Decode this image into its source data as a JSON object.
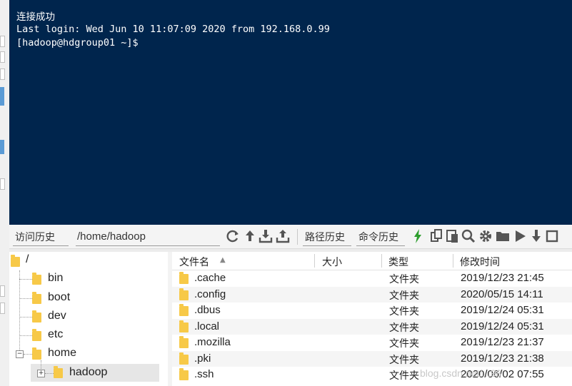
{
  "terminal": {
    "line1": "连接成功",
    "line2": "Last login: Wed Jun 10 11:07:09 2020 from 192.168.0.99",
    "line3": "[hadoop@hdgroup01 ~]$"
  },
  "toolbar": {
    "history_label": "访问历史",
    "path_value": "/home/hadoop",
    "path_history_label": "路径历史",
    "command_history_label": "命令历史"
  },
  "tree": {
    "root": "/",
    "items": [
      "bin",
      "boot",
      "dev",
      "etc",
      "home"
    ],
    "selected": "hadoop"
  },
  "filelist": {
    "columns": [
      "文件名",
      "大小",
      "类型",
      "修改时间"
    ],
    "rows": [
      {
        "name": ".cache",
        "size": "",
        "type": "文件夹",
        "modified": "2019/12/23 21:45"
      },
      {
        "name": ".config",
        "size": "",
        "type": "文件夹",
        "modified": "2020/05/15 14:11"
      },
      {
        "name": ".dbus",
        "size": "",
        "type": "文件夹",
        "modified": "2019/12/24 05:31"
      },
      {
        "name": ".local",
        "size": "",
        "type": "文件夹",
        "modified": "2019/12/24 05:31"
      },
      {
        "name": ".mozilla",
        "size": "",
        "type": "文件夹",
        "modified": "2019/12/23 21:37"
      },
      {
        "name": ".pki",
        "size": "",
        "type": "文件夹",
        "modified": "2019/12/23 21:38"
      },
      {
        "name": ".ssh",
        "size": "",
        "type": "文件夹",
        "modified": "2020/06/02 07:55"
      }
    ]
  },
  "watermark": "blog.csdn.net/...98",
  "colors": {
    "terminal_bg": "#00254d",
    "folder": "#f7c948",
    "accent_green": "#2e9e2e"
  },
  "icons": [
    "refresh-icon",
    "upload-icon",
    "download-icon",
    "upload-file-icon",
    "lightning-icon",
    "copy-icon",
    "paste-icon",
    "search-icon",
    "gear-icon",
    "folder-icon",
    "play-icon",
    "arrow-down-icon",
    "more-icon"
  ]
}
